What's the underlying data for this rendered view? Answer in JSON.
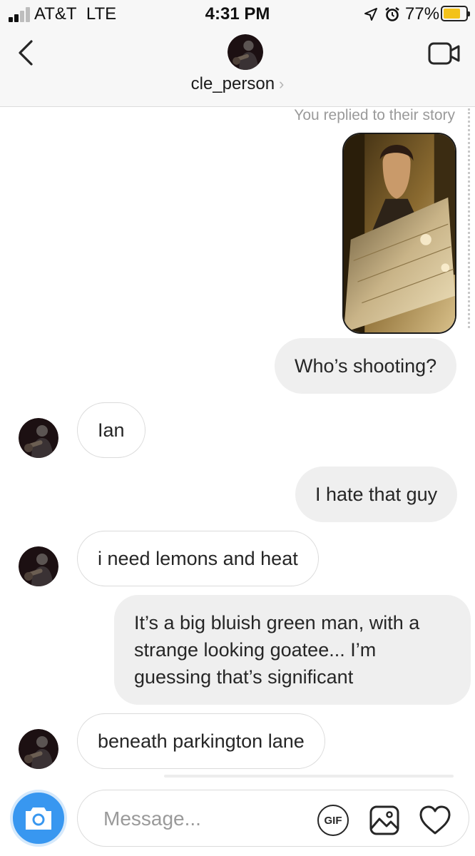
{
  "status_bar": {
    "carrier": "AT&T",
    "network": "LTE",
    "time": "4:31 PM",
    "battery_percent": "77%",
    "battery_level": 0.77,
    "icons": [
      "signal-icon",
      "location-arrow-icon",
      "alarm-icon",
      "battery-icon"
    ]
  },
  "header": {
    "username": "cle_person",
    "chevron": "›",
    "icons": [
      "back-chevron-icon",
      "video-call-icon"
    ]
  },
  "conversation": {
    "story_reply_note": "You replied to their story",
    "messages": [
      {
        "direction": "out",
        "text": "Who’s shooting?"
      },
      {
        "direction": "in",
        "text": "Ian"
      },
      {
        "direction": "out",
        "text": "I hate that guy"
      },
      {
        "direction": "in",
        "text": "i need lemons and heat"
      },
      {
        "direction": "out",
        "text": "It’s a big bluish green man, with a strange looking goatee... I’m guessing that’s significant"
      },
      {
        "direction": "in",
        "text": "beneath parkington lane"
      }
    ]
  },
  "composer": {
    "placeholder": "Message...",
    "gif_label": "GIF",
    "icons": [
      "camera-icon",
      "gallery-icon",
      "heart-icon"
    ]
  },
  "colors": {
    "accent": "#3897f0",
    "outgoing_bubble": "#efefef",
    "incoming_border": "#dbdbdb",
    "battery_fill": "#f3c21a"
  }
}
